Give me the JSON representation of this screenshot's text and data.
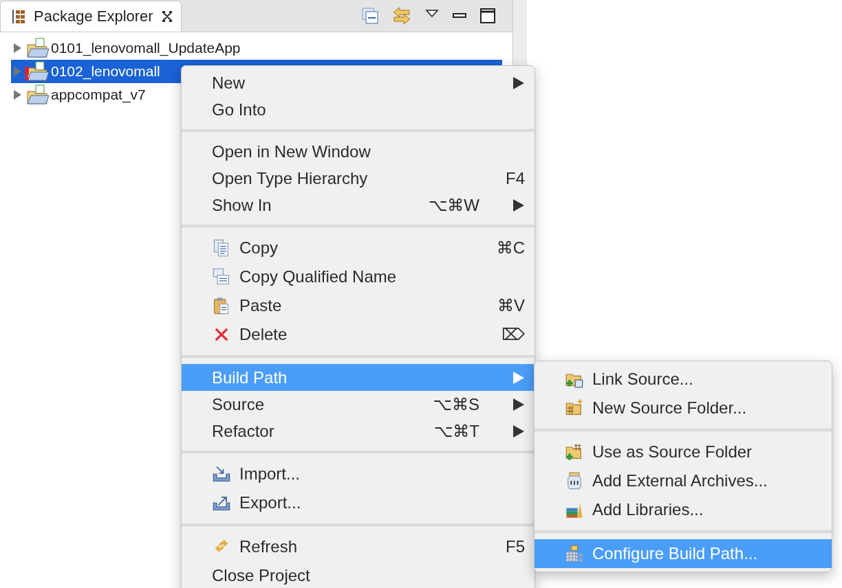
{
  "explorer": {
    "title": "Package Explorer",
    "tree": [
      {
        "label": "0101_lenovomall_UpdateApp",
        "expanded": false,
        "selected": false,
        "error": false
      },
      {
        "label": "0102_lenovomall",
        "expanded": false,
        "selected": true,
        "error": true
      },
      {
        "label": "appcompat_v7",
        "expanded": false,
        "selected": false,
        "error": false
      }
    ]
  },
  "context_menu": {
    "groups": [
      [
        {
          "label": "New",
          "submenu": true,
          "selected": false
        },
        {
          "label": "Go Into",
          "submenu": false,
          "selected": false
        }
      ],
      [
        {
          "label": "Open in New Window",
          "submenu": false,
          "selected": false
        },
        {
          "label": "Open Type Hierarchy",
          "shortcut": "F4",
          "submenu": false,
          "selected": false
        },
        {
          "label": "Show In",
          "shortcut": "⌥⌘W",
          "submenu": true,
          "selected": false
        }
      ],
      [
        {
          "label": "Copy",
          "shortcut": "⌘C",
          "submenu": false,
          "selected": false
        },
        {
          "label": "Copy Qualified Name",
          "submenu": false,
          "selected": false
        },
        {
          "label": "Paste",
          "shortcut": "⌘V",
          "submenu": false,
          "selected": false
        },
        {
          "label": "Delete",
          "shortcut": "⌦",
          "submenu": false,
          "selected": false
        }
      ],
      [
        {
          "label": "Build Path",
          "submenu": true,
          "selected": true
        },
        {
          "label": "Source",
          "shortcut": "⌥⌘S",
          "submenu": true,
          "selected": false
        },
        {
          "label": "Refactor",
          "shortcut": "⌥⌘T",
          "submenu": true,
          "selected": false
        }
      ],
      [
        {
          "label": "Import...",
          "submenu": false,
          "selected": false
        },
        {
          "label": "Export...",
          "submenu": false,
          "selected": false
        }
      ],
      [
        {
          "label": "Refresh",
          "shortcut": "F5",
          "submenu": false,
          "selected": false
        },
        {
          "label": "Close Project",
          "submenu": false,
          "selected": false
        }
      ]
    ]
  },
  "submenu": {
    "groups": [
      [
        {
          "label": "Link Source...",
          "selected": false
        },
        {
          "label": "New Source Folder...",
          "selected": false
        }
      ],
      [
        {
          "label": "Use as Source Folder",
          "selected": false
        },
        {
          "label": "Add External Archives...",
          "selected": false
        },
        {
          "label": "Add Libraries...",
          "selected": false
        }
      ],
      [
        {
          "label": "Configure Build Path...",
          "selected": true
        }
      ]
    ]
  }
}
